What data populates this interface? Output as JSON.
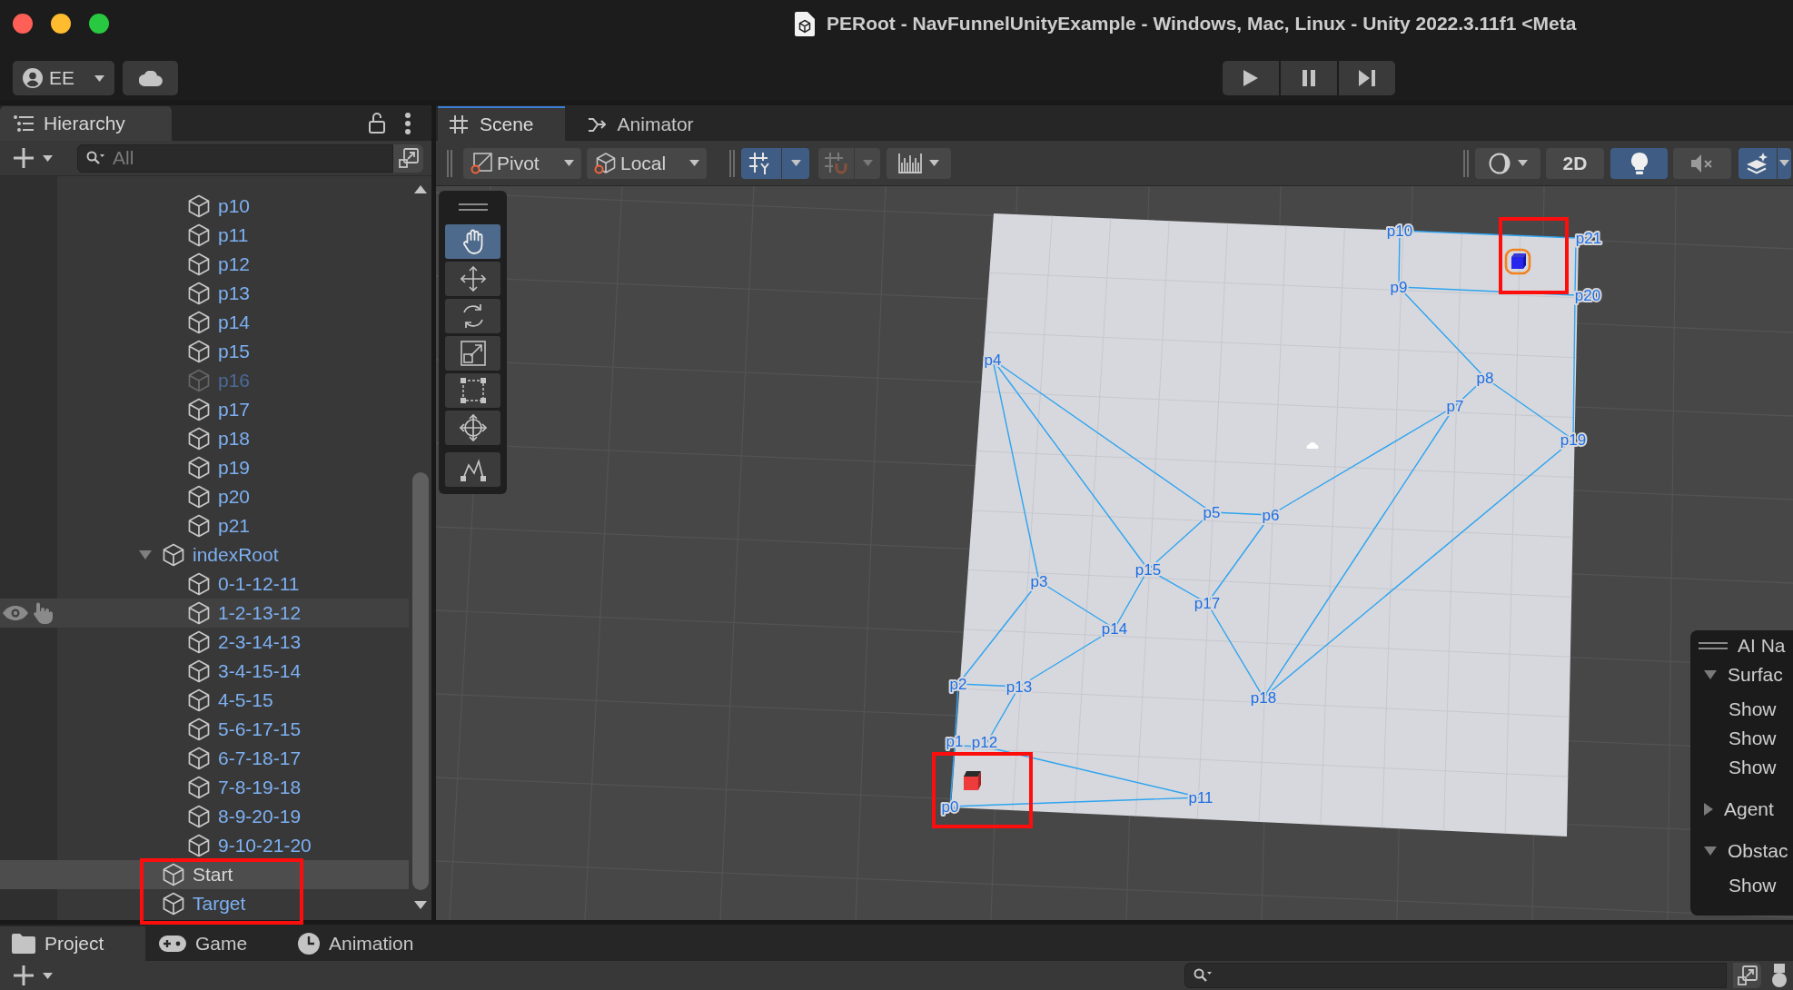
{
  "window": {
    "title": "PERoot - NavFunnelUnityExample - Windows, Mac, Linux - Unity 2022.3.11f1 <Meta"
  },
  "main_toolbar": {
    "account": "EE"
  },
  "hierarchy": {
    "title": "Hierarchy",
    "search": {
      "placeholder": "All"
    },
    "items": [
      {
        "children": [
          {
            "label": "p10",
            "prefab": true,
            "active": true,
            "selected": false,
            "hovered": false
          },
          {
            "label": "p11",
            "prefab": true,
            "active": true,
            "selected": false,
            "hovered": false
          },
          {
            "label": "p12",
            "prefab": true,
            "active": true,
            "selected": false,
            "hovered": false
          },
          {
            "label": "p13",
            "prefab": true,
            "active": true,
            "selected": false,
            "hovered": false
          },
          {
            "label": "p14",
            "prefab": true,
            "active": true,
            "selected": false,
            "hovered": false
          },
          {
            "label": "p15",
            "prefab": true,
            "active": true,
            "selected": false,
            "hovered": false
          },
          {
            "label": "p16",
            "prefab": true,
            "active": false,
            "selected": false,
            "hovered": false
          },
          {
            "label": "p17",
            "prefab": true,
            "active": true,
            "selected": false,
            "hovered": false
          },
          {
            "label": "p18",
            "prefab": true,
            "active": true,
            "selected": false,
            "hovered": false
          },
          {
            "label": "p19",
            "prefab": true,
            "active": true,
            "selected": false,
            "hovered": false
          },
          {
            "label": "p20",
            "prefab": true,
            "active": true,
            "selected": false,
            "hovered": false
          },
          {
            "label": "p21",
            "prefab": true,
            "active": true,
            "selected": false,
            "hovered": false
          }
        ]
      },
      {
        "label": "indexRoot",
        "prefab": true,
        "active": true,
        "selected": false,
        "hovered": false,
        "expanded": true,
        "children": [
          {
            "label": "0-1-12-11",
            "prefab": true,
            "active": true,
            "selected": false,
            "hovered": false
          },
          {
            "label": "1-2-13-12",
            "prefab": true,
            "active": true,
            "selected": false,
            "hovered": true
          },
          {
            "label": "2-3-14-13",
            "prefab": true,
            "active": true,
            "selected": false,
            "hovered": false
          },
          {
            "label": "3-4-15-14",
            "prefab": true,
            "active": true,
            "selected": false,
            "hovered": false
          },
          {
            "label": "4-5-15",
            "prefab": true,
            "active": true,
            "selected": false,
            "hovered": false
          },
          {
            "label": "5-6-17-15",
            "prefab": true,
            "active": true,
            "selected": false,
            "hovered": false
          },
          {
            "label": "6-7-18-17",
            "prefab": true,
            "active": true,
            "selected": false,
            "hovered": false
          },
          {
            "label": "7-8-19-18",
            "prefab": true,
            "active": true,
            "selected": false,
            "hovered": false
          },
          {
            "label": "8-9-20-19",
            "prefab": true,
            "active": true,
            "selected": false,
            "hovered": false
          },
          {
            "label": "9-10-21-20",
            "prefab": true,
            "active": true,
            "selected": false,
            "hovered": false
          }
        ]
      },
      {
        "label": "Start",
        "prefab": false,
        "active": true,
        "selected": true,
        "hovered": false
      },
      {
        "label": "Target",
        "prefab": true,
        "active": true,
        "selected": false,
        "hovered": false
      }
    ]
  },
  "scene": {
    "tabs": [
      {
        "kind": "scene",
        "label": "Scene",
        "selected": true
      },
      {
        "kind": "animator",
        "label": "Animator",
        "selected": false
      }
    ],
    "toolbar": {
      "pivot": "Pivot",
      "handle_space": "Local",
      "left": [
        {
          "kind": "gridsnap",
          "on": true,
          "disabled": false
        },
        {
          "kind": "incrementsnap",
          "on": false,
          "disabled": true
        },
        {
          "kind": "gridvisibility",
          "on": false,
          "disabled": false
        }
      ],
      "right": [
        {
          "kind": "shading",
          "on": false
        },
        {
          "kind": "dimension",
          "label": "2D",
          "on": false
        },
        {
          "kind": "lighting",
          "on": true
        },
        {
          "kind": "audio",
          "on": false
        },
        {
          "kind": "effects",
          "on": true
        }
      ]
    },
    "tools": [
      {
        "kind": "hand",
        "selected": true
      },
      {
        "kind": "move",
        "selected": false
      },
      {
        "kind": "rotate",
        "selected": false
      },
      {
        "kind": "scale",
        "selected": false
      },
      {
        "kind": "rect",
        "selected": false
      },
      {
        "kind": "transform",
        "selected": false
      },
      {
        "kind": "custom",
        "selected": false
      }
    ],
    "vertex_labels": [
      "p10",
      "p21",
      "p9",
      "p20",
      "p4",
      "p8",
      "p7",
      "p19",
      "p5",
      "p6",
      "p15",
      "p3",
      "p17",
      "p14",
      "p2",
      "p13",
      "p18",
      "p1",
      "p12",
      "p11",
      "p0"
    ],
    "overlay": {
      "title": "AI Na",
      "sections": [
        {
          "label": "Surfac",
          "expanded": true,
          "rows": [
            "Show",
            "Show",
            "Show"
          ]
        },
        {
          "label": "Agent",
          "expanded": false
        },
        {
          "label": "Obstac",
          "expanded": true,
          "rows": [
            "Show"
          ]
        }
      ]
    }
  },
  "bottom": {
    "tabs": [
      {
        "kind": "project",
        "label": "Project",
        "selected": true
      },
      {
        "kind": "game",
        "label": "Game",
        "selected": false
      },
      {
        "kind": "animation",
        "label": "Animation",
        "selected": false
      }
    ]
  }
}
